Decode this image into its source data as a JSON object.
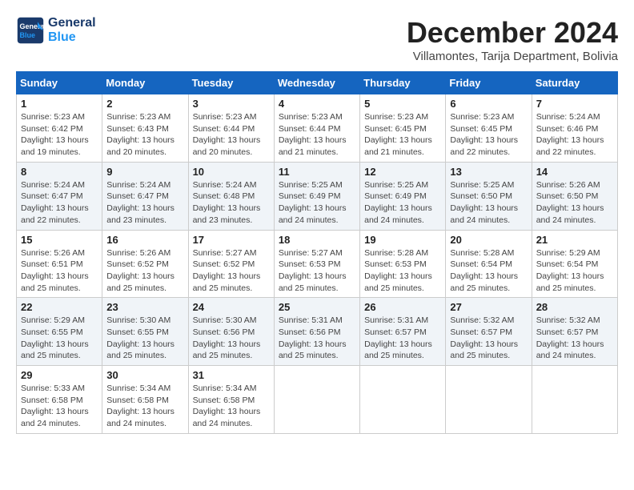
{
  "header": {
    "logo": {
      "line1": "General",
      "line2": "Blue"
    },
    "title": "December 2024",
    "subtitle": "Villamontes, Tarija Department, Bolivia"
  },
  "weekdays": [
    "Sunday",
    "Monday",
    "Tuesday",
    "Wednesday",
    "Thursday",
    "Friday",
    "Saturday"
  ],
  "weeks": [
    [
      {
        "day": "1",
        "info": "Sunrise: 5:23 AM\nSunset: 6:42 PM\nDaylight: 13 hours and 19 minutes."
      },
      {
        "day": "2",
        "info": "Sunrise: 5:23 AM\nSunset: 6:43 PM\nDaylight: 13 hours and 20 minutes."
      },
      {
        "day": "3",
        "info": "Sunrise: 5:23 AM\nSunset: 6:44 PM\nDaylight: 13 hours and 20 minutes."
      },
      {
        "day": "4",
        "info": "Sunrise: 5:23 AM\nSunset: 6:44 PM\nDaylight: 13 hours and 21 minutes."
      },
      {
        "day": "5",
        "info": "Sunrise: 5:23 AM\nSunset: 6:45 PM\nDaylight: 13 hours and 21 minutes."
      },
      {
        "day": "6",
        "info": "Sunrise: 5:23 AM\nSunset: 6:45 PM\nDaylight: 13 hours and 22 minutes."
      },
      {
        "day": "7",
        "info": "Sunrise: 5:24 AM\nSunset: 6:46 PM\nDaylight: 13 hours and 22 minutes."
      }
    ],
    [
      {
        "day": "8",
        "info": "Sunrise: 5:24 AM\nSunset: 6:47 PM\nDaylight: 13 hours and 22 minutes."
      },
      {
        "day": "9",
        "info": "Sunrise: 5:24 AM\nSunset: 6:47 PM\nDaylight: 13 hours and 23 minutes."
      },
      {
        "day": "10",
        "info": "Sunrise: 5:24 AM\nSunset: 6:48 PM\nDaylight: 13 hours and 23 minutes."
      },
      {
        "day": "11",
        "info": "Sunrise: 5:25 AM\nSunset: 6:49 PM\nDaylight: 13 hours and 24 minutes."
      },
      {
        "day": "12",
        "info": "Sunrise: 5:25 AM\nSunset: 6:49 PM\nDaylight: 13 hours and 24 minutes."
      },
      {
        "day": "13",
        "info": "Sunrise: 5:25 AM\nSunset: 6:50 PM\nDaylight: 13 hours and 24 minutes."
      },
      {
        "day": "14",
        "info": "Sunrise: 5:26 AM\nSunset: 6:50 PM\nDaylight: 13 hours and 24 minutes."
      }
    ],
    [
      {
        "day": "15",
        "info": "Sunrise: 5:26 AM\nSunset: 6:51 PM\nDaylight: 13 hours and 25 minutes."
      },
      {
        "day": "16",
        "info": "Sunrise: 5:26 AM\nSunset: 6:52 PM\nDaylight: 13 hours and 25 minutes."
      },
      {
        "day": "17",
        "info": "Sunrise: 5:27 AM\nSunset: 6:52 PM\nDaylight: 13 hours and 25 minutes."
      },
      {
        "day": "18",
        "info": "Sunrise: 5:27 AM\nSunset: 6:53 PM\nDaylight: 13 hours and 25 minutes."
      },
      {
        "day": "19",
        "info": "Sunrise: 5:28 AM\nSunset: 6:53 PM\nDaylight: 13 hours and 25 minutes."
      },
      {
        "day": "20",
        "info": "Sunrise: 5:28 AM\nSunset: 6:54 PM\nDaylight: 13 hours and 25 minutes."
      },
      {
        "day": "21",
        "info": "Sunrise: 5:29 AM\nSunset: 6:54 PM\nDaylight: 13 hours and 25 minutes."
      }
    ],
    [
      {
        "day": "22",
        "info": "Sunrise: 5:29 AM\nSunset: 6:55 PM\nDaylight: 13 hours and 25 minutes."
      },
      {
        "day": "23",
        "info": "Sunrise: 5:30 AM\nSunset: 6:55 PM\nDaylight: 13 hours and 25 minutes."
      },
      {
        "day": "24",
        "info": "Sunrise: 5:30 AM\nSunset: 6:56 PM\nDaylight: 13 hours and 25 minutes."
      },
      {
        "day": "25",
        "info": "Sunrise: 5:31 AM\nSunset: 6:56 PM\nDaylight: 13 hours and 25 minutes."
      },
      {
        "day": "26",
        "info": "Sunrise: 5:31 AM\nSunset: 6:57 PM\nDaylight: 13 hours and 25 minutes."
      },
      {
        "day": "27",
        "info": "Sunrise: 5:32 AM\nSunset: 6:57 PM\nDaylight: 13 hours and 25 minutes."
      },
      {
        "day": "28",
        "info": "Sunrise: 5:32 AM\nSunset: 6:57 PM\nDaylight: 13 hours and 24 minutes."
      }
    ],
    [
      {
        "day": "29",
        "info": "Sunrise: 5:33 AM\nSunset: 6:58 PM\nDaylight: 13 hours and 24 minutes."
      },
      {
        "day": "30",
        "info": "Sunrise: 5:34 AM\nSunset: 6:58 PM\nDaylight: 13 hours and 24 minutes."
      },
      {
        "day": "31",
        "info": "Sunrise: 5:34 AM\nSunset: 6:58 PM\nDaylight: 13 hours and 24 minutes."
      },
      null,
      null,
      null,
      null
    ]
  ]
}
